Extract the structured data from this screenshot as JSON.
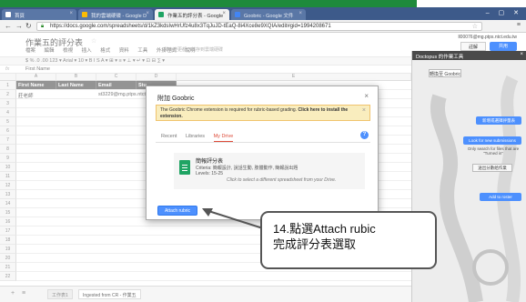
{
  "browser": {
    "tabs": [
      {
        "title": "首頁",
        "color": "#ffffff"
      },
      {
        "title": "我的雲端硬碟 - Google D",
        "color": "#fbbc05"
      },
      {
        "title": "作業五的評分表 - Google",
        "color": "#1fa463"
      },
      {
        "title": "Goobric - Google 文件",
        "color": "#4285f4"
      }
    ],
    "url": "https://docs.google.com/spreadsheets/d/1kZ3kdsIwHrUfz4u8x3TqJuJD-tEaQ-8i4Xce8e9XQIA/edit#gid=1994208671",
    "nav_icons": [
      "back-icon",
      "forward-icon",
      "reload-icon"
    ]
  },
  "sheet": {
    "title": "作業五的評分表",
    "menu": [
      "檔案",
      "編輯",
      "檢視",
      "插入",
      "格式",
      "資料",
      "工具",
      "外掛程式",
      "說明"
    ],
    "saved_note": "所有變更都已儲存到雲端硬碟",
    "account": "ll00076@mg.ptps.ntct.edu.tw",
    "comments_label": "註解",
    "share_label": "共用",
    "toolbar_text": "$  %  .0  .00  123 ▾   Arial  ▾   10  ▾   B  I  S  A ▾   ⊞ ▾   ≡ ▾   ⊥ ▾   ↵ ▾   ⊡   ⊟   ∑ ▾",
    "formula_value": "First Name",
    "columns": [
      "A",
      "B",
      "C",
      "D",
      "E"
    ],
    "header_cells": [
      "First Name",
      "Last Name",
      "Email",
      "Stu"
    ],
    "data_row": {
      "first": "莊老師",
      "email": "st3229@mg.ptps.ntct"
    },
    "row_numbers": [
      "1",
      "2",
      "3",
      "4",
      "5",
      "6",
      "7",
      "8",
      "9",
      "10",
      "11",
      "12",
      "13",
      "14",
      "15",
      "16",
      "17",
      "18",
      "19",
      "20",
      "21",
      "22"
    ],
    "sheet_tabs": [
      "工作表1",
      "Ingested from CR - 作業五"
    ]
  },
  "sidebar": {
    "title": "Doctopus 的作業工具",
    "chip": "轉換至 Goobric",
    "btn_attach": "新增或選擇評量表",
    "btn_submissions": "Look for new submissions",
    "note": "Only search for files that are \"Turned in\"",
    "btn_gray": "送出分數給作業",
    "btn_roster": "Add to roster"
  },
  "modal": {
    "title": "附加 Goobric",
    "notice_text": "The Goobric Chrome extension is required for rubric-based grading.",
    "notice_link": "Click here to install the extension.",
    "tabs": [
      "Recent",
      "Libraries",
      "My Drive"
    ],
    "active_tab": "My Drive",
    "file": {
      "name": "簡報評分表",
      "criteria": "Criteria: 簡報設計, 說話生動, 肢體動作, 簡報說出題",
      "levels": "Levels: 15-25",
      "hint": "Click to select a different spreadsheet from your Drive."
    },
    "attach_button": "Attach rubric"
  },
  "annotation": {
    "line1": "14.點選Attach rubic",
    "line2": "完成評分表選取"
  },
  "colors": {
    "tabbar": "#3d5a8a",
    "accent_blue": "#4d90fe",
    "sheet_green": "#1fa463",
    "active_tab_red": "#dd4b39",
    "notice_yellow": "#f9edbe"
  }
}
